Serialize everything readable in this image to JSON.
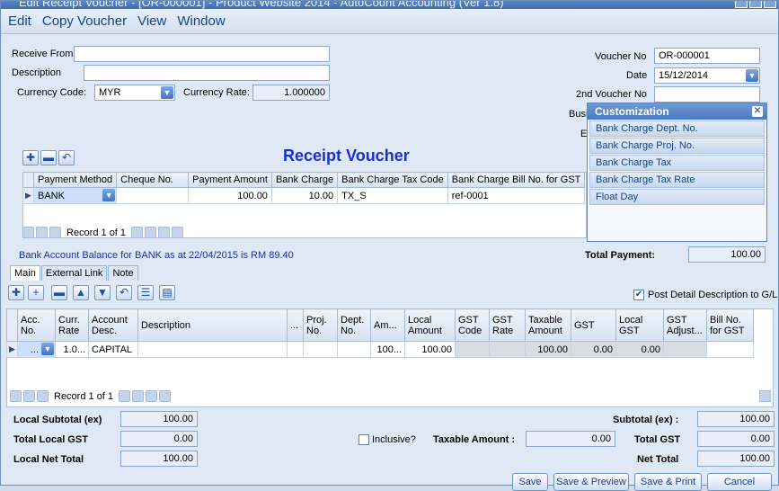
{
  "window": {
    "title": "Edit Receipt Voucher - [OR-000001] - Product Website 2014 - AutoCount Accounting (Ver 1.8)"
  },
  "menu": [
    "Edit",
    "Copy Voucher",
    "View",
    "Window"
  ],
  "form": {
    "receive_from_label": "Receive From",
    "description_label": "Description",
    "currency_code_label": "Currency Code:",
    "currency_code": "MYR",
    "currency_rate_label": "Currency Rate:",
    "currency_rate": "1.000000",
    "voucher_no_label": "Voucher No",
    "voucher_no": "OR-000001",
    "date_label": "Date",
    "date": "15/12/2014",
    "second_voucher_label": "2nd Voucher No",
    "busi_label": "Busi",
    "e_label": "E"
  },
  "heading": "Receipt Voucher",
  "payment_grid": {
    "columns": [
      "Payment Method",
      "Cheque No.",
      "Payment Amount",
      "Bank Charge",
      "Bank Charge Tax Code",
      "Bank Charge Bill No. for GST"
    ],
    "rows": [
      [
        "BANK",
        "",
        "100.00",
        "10.00",
        "TX_S",
        "ref-0001"
      ]
    ],
    "record_text": "Record 1 of 1"
  },
  "balance_text": "Bank Account Balance for BANK as at 22/04/2015 is RM 89.40",
  "total_payment_label": "Total Payment:",
  "total_payment": "100.00",
  "customization": {
    "title": "Customization",
    "items": [
      "Bank Charge Dept. No.",
      "Bank Charge Proj. No.",
      "Bank Charge Tax",
      "Bank Charge Tax Rate",
      "Float Day"
    ]
  },
  "tabs": [
    "Main",
    "External Link",
    "Note"
  ],
  "post_detail_label": "Post Detail Description to G/L",
  "detail_grid": {
    "columns": [
      "Acc. No.",
      "Curr. Rate",
      "Account Desc.",
      "Description",
      "...",
      "Proj. No.",
      "Dept. No.",
      "Am...",
      "Local Amount",
      "GST Code",
      "GST Rate",
      "Taxable Amount",
      "GST",
      "Local GST",
      "GST Adjust...",
      "Bill No. for GST"
    ],
    "rows": [
      [
        "...",
        "1.0...",
        "CAPITAL",
        "",
        "",
        "",
        "",
        "100...",
        "100.00",
        "",
        "",
        "100.00",
        "0.00",
        "0.00",
        "",
        ""
      ]
    ],
    "record_text": "Record 1 of 1"
  },
  "totals": {
    "local_subtotal_label": "Local Subtotal (ex)",
    "local_subtotal": "100.00",
    "total_local_gst_label": "Total Local GST",
    "total_local_gst": "0.00",
    "local_net_total_label": "Local Net Total",
    "local_net_total": "100.00",
    "inclusive_label": "Inclusive?",
    "taxable_amount_label": "Taxable Amount :",
    "taxable_amount": "0.00",
    "subtotal_label": "Subtotal (ex) :",
    "subtotal": "100.00",
    "total_gst_label": "Total GST",
    "total_gst": "0.00",
    "net_total_label": "Net Total",
    "net_total": "100.00"
  },
  "buttons": {
    "save": "Save",
    "save_preview": "Save & Preview",
    "save_print": "Save & Print",
    "cancel": "Cancel"
  }
}
